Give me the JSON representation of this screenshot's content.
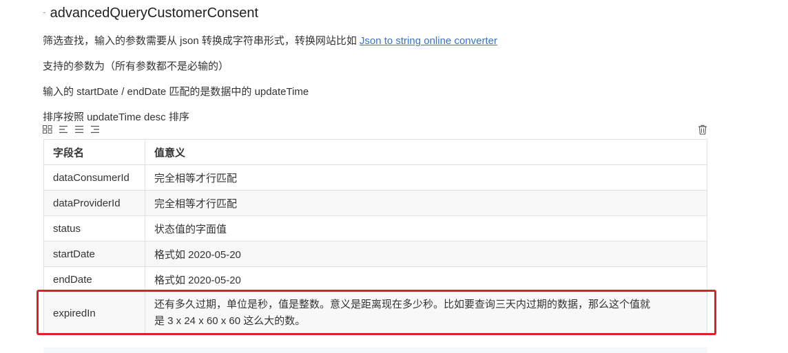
{
  "heading": {
    "title": "advancedQueryCustomerConsent"
  },
  "paragraphs": {
    "p1_text": "筛选查找，输入的参数需要从 json 转换成字符串形式，转换网站比如",
    "p1_link": "Json to string online converter",
    "p2": "支持的参数为（所有参数都不是必输的）",
    "p3": "输入的 startDate / endDate 匹配的是数据中的 updateTime",
    "p4": "排序按照 updateTime desc 排序"
  },
  "toolbar": {
    "icons": [
      "grid-icon",
      "align-left-icon",
      "align-center-icon",
      "align-right-icon"
    ],
    "delete_icon": "trash-icon"
  },
  "table": {
    "headers": [
      "字段名",
      "值意义"
    ],
    "rows": [
      {
        "field": "dataConsumerId",
        "meaning": "完全相等才行匹配"
      },
      {
        "field": "dataProviderId",
        "meaning": "完全相等才行匹配"
      },
      {
        "field": "status",
        "meaning": "状态值的字面值"
      },
      {
        "field": "startDate",
        "meaning": "格式如 2020-05-20"
      },
      {
        "field": "endDate",
        "meaning": "格式如 2020-05-20"
      },
      {
        "field": "expiredIn",
        "meaning_line1": "还有多久过期，单位是秒，值是整数。意义是距离现在多少秒。比如要查询三天内过期的数据，那么这个值就",
        "meaning_line2": "是 3 x 24 x 60 x 60 这么大的数。"
      }
    ]
  },
  "colors": {
    "link": "#3873c4",
    "highlight": "#e02020",
    "border": "#dfe2e5"
  }
}
